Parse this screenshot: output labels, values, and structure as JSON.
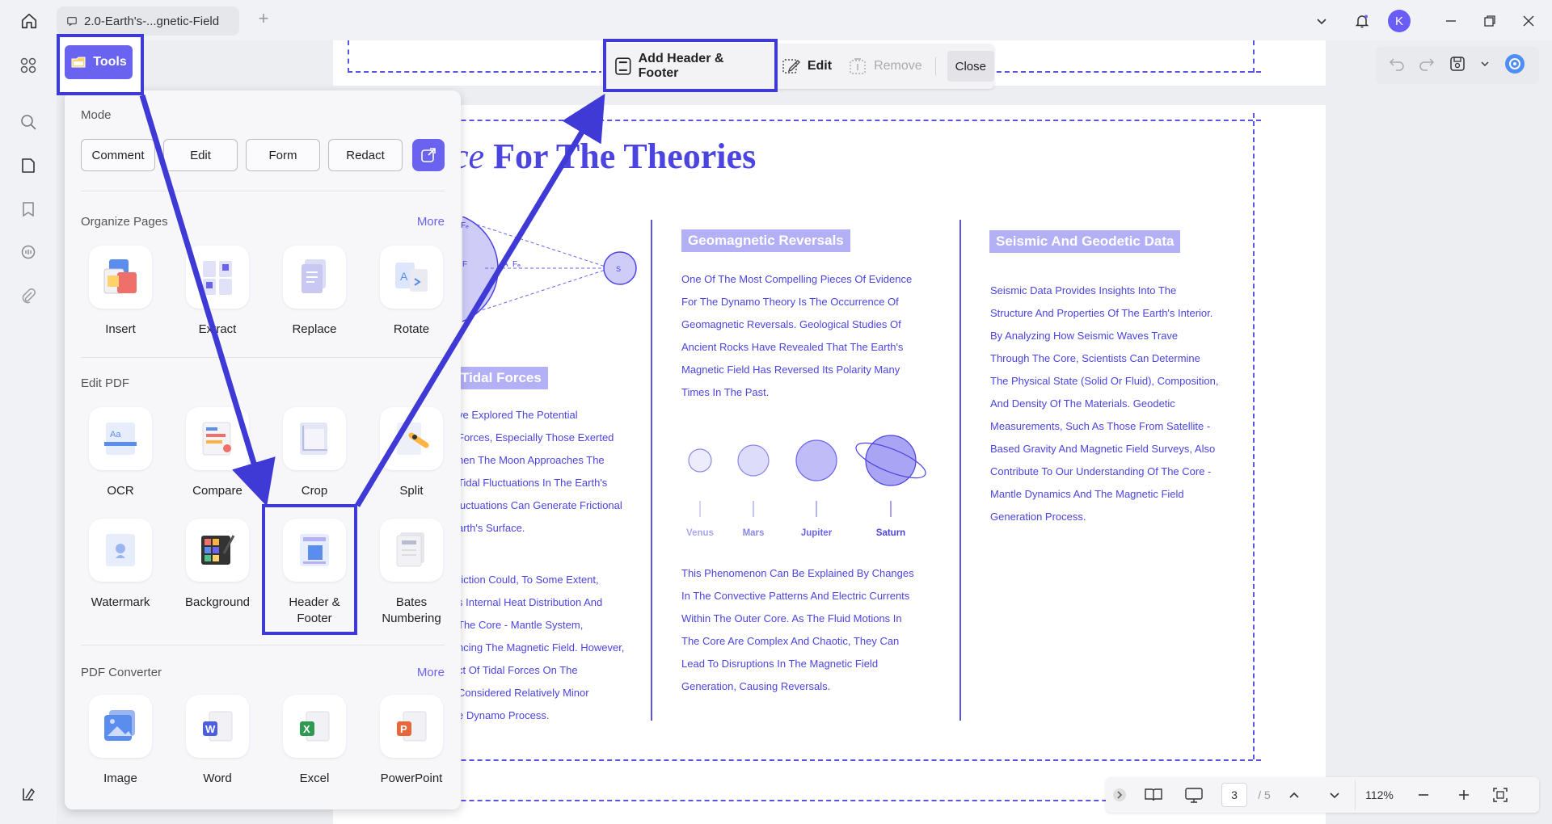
{
  "tab": {
    "title": "2.0-Earth's-...gnetic-Field",
    "add": "+"
  },
  "user": {
    "initial": "K"
  },
  "tools_button": {
    "label": "Tools"
  },
  "panel": {
    "mode_label": "Mode",
    "modes": [
      "Comment",
      "Edit",
      "Form",
      "Redact"
    ],
    "organize_label": "Organize Pages",
    "organize_more": "More",
    "organize_tools": [
      "Insert",
      "Extract",
      "Replace",
      "Rotate"
    ],
    "edit_label": "Edit PDF",
    "edit_tools_row1": [
      "OCR",
      "Compare",
      "Crop",
      "Split"
    ],
    "edit_tools_row2": [
      "Watermark",
      "Background",
      "Header & Footer",
      "Bates Numbering"
    ],
    "converter_label": "PDF Converter",
    "converter_more": "More",
    "converter_tools": [
      "Image",
      "Word",
      "Excel",
      "PowerPoint"
    ]
  },
  "hf_toolbar": {
    "add": "Add Header & Footer",
    "edit": "Edit",
    "remove": "Remove",
    "close": "Close"
  },
  "document": {
    "title_italic": "ce",
    "title_main": "For The Theories",
    "sec_tidal": "Tidal Forces",
    "sec_geo": "Geomagnetic Reversals",
    "sec_seismic": "Seismic And Geodetic Data",
    "col1_para1": [
      "ve Explored The Potential",
      " Forces, Especially Those Exerted",
      "hen The Moon Approaches The",
      "Tidal Fluctuations In The Earth's",
      "luctuations Can Generate Frictional",
      "arth's Surface."
    ],
    "col1_para2": [
      "riction Could, To Some Extent,",
      "s Internal Heat Distribution And",
      " The Core - Mantle System,",
      "ncing The Magnetic Field. However,",
      "ct Of Tidal Forces On The",
      " Considered Relatively Minor",
      "e Dynamo Process."
    ],
    "col2_para1": [
      "One Of The Most Compelling Pieces Of Evidence",
      "For The Dynamo Theory Is The Occurrence Of",
      "Geomagnetic Reversals. Geological Studies Of",
      "Ancient Rocks Have Revealed That The Earth's",
      "Magnetic Field Has Reversed Its Polarity Many",
      "Times In The Past."
    ],
    "col2_para2": [
      "This Phenomenon Can Be Explained By Changes",
      "In The Convective Patterns And Electric Currents",
      "Within The Outer Core. As The Fluid Motions In",
      "The Core Are Complex And Chaotic, They Can",
      "Lead To Disruptions In The Magnetic Field",
      "Generation, Causing Reversals."
    ],
    "col3_para": [
      "Seismic Data Provides Insights Into The",
      "Structure And Properties Of The Earth's Interior.",
      "By Analyzing How Seismic Waves Trave",
      "Through The Core, Scientists Can Determine",
      "The Physical State (Solid Or Fluid), Composition,",
      "And Density Of The Materials. Geodetic",
      "Measurements, Such As Those From Satellite -",
      "Based Gravity And Magnetic Field Surveys, Also",
      "Contribute To Our Understanding Of The Core -",
      "Mantle Dynamics And The Magnetic Field",
      "Generation Process."
    ],
    "planets": [
      "Venus",
      "Mars",
      "Jupiter",
      "Saturn"
    ],
    "diagram_labels": {
      "fe1": "Fₑ",
      "fe2": "Fₑ",
      "fe3": "F",
      "a": "A",
      "s": "S"
    }
  },
  "status": {
    "page": "3",
    "total": "/ 5",
    "zoom": "112%"
  },
  "colors": {
    "accent": "#6a63f0",
    "highlight": "#3f3ad6",
    "doc_blue": "#4b44e0"
  }
}
